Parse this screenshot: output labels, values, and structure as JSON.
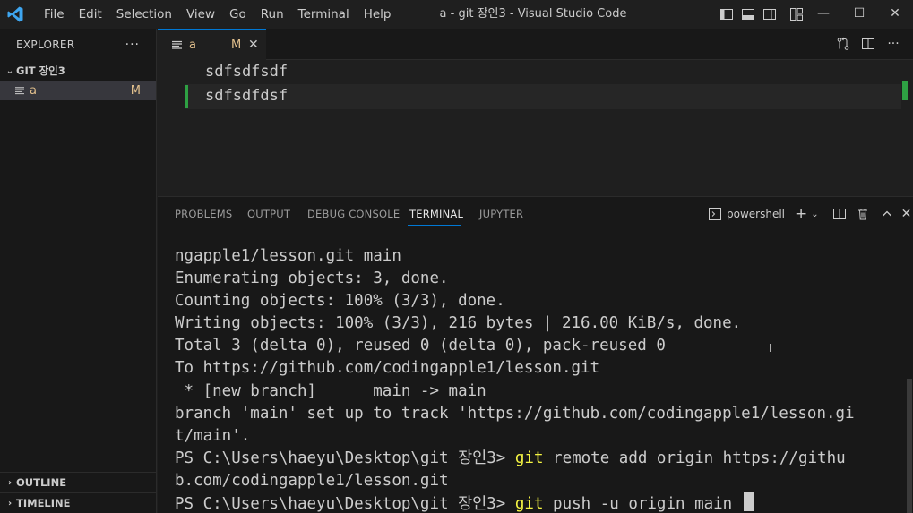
{
  "titlebar": {
    "menu": [
      "File",
      "Edit",
      "Selection",
      "View",
      "Go",
      "Run",
      "Terminal",
      "Help"
    ],
    "title": "a - git 장인3 - Visual Studio Code",
    "controls": {
      "minimize": "—",
      "maximize": "☐",
      "close": "✕"
    }
  },
  "sidebar": {
    "title": "EXPLORER",
    "more": "···",
    "folder": "GIT 장인3",
    "files": [
      {
        "name": "a",
        "badge": "M"
      }
    ],
    "sections": [
      "OUTLINE",
      "TIMELINE"
    ]
  },
  "tabs": [
    {
      "label": "a",
      "badge": "M",
      "close": "✕"
    }
  ],
  "editor": {
    "lines": [
      "sdfsdfsdf",
      "sdfsdfdsf"
    ]
  },
  "panel": {
    "tabs": [
      "PROBLEMS",
      "OUTPUT",
      "DEBUG CONSOLE",
      "TERMINAL",
      "JUPYTER"
    ],
    "active_tab": "TERMINAL",
    "shell": "powershell",
    "terminal_lines": [
      "ngapple1/lesson.git main",
      "Enumerating objects: 3, done.",
      "Counting objects: 100% (3/3), done.",
      "Writing objects: 100% (3/3), 216 bytes | 216.00 KiB/s, done.",
      "Total 3 (delta 0), reused 0 (delta 0), pack-reused 0",
      "To https://github.com/codingapple1/lesson.git",
      " * [new branch]      main -> main",
      "branch 'main' set up to track 'https://github.com/codingapple1/lesson.gi",
      "t/main'."
    ],
    "prompt": "PS C:\\Users\\haeyu\\Desktop\\git 장인3> ",
    "cmd1_kw": "git",
    "cmd1_rest": " remote add origin https://githu",
    "cmd1_wrap": "b.com/codingapple1/lesson.git",
    "cmd2_kw": "git",
    "cmd2_rest": " push -u origin main "
  },
  "colors": {
    "accent": "#0078d4",
    "modified": "#e2c08d",
    "added": "#2ea043",
    "keyword": "#f5f543"
  }
}
